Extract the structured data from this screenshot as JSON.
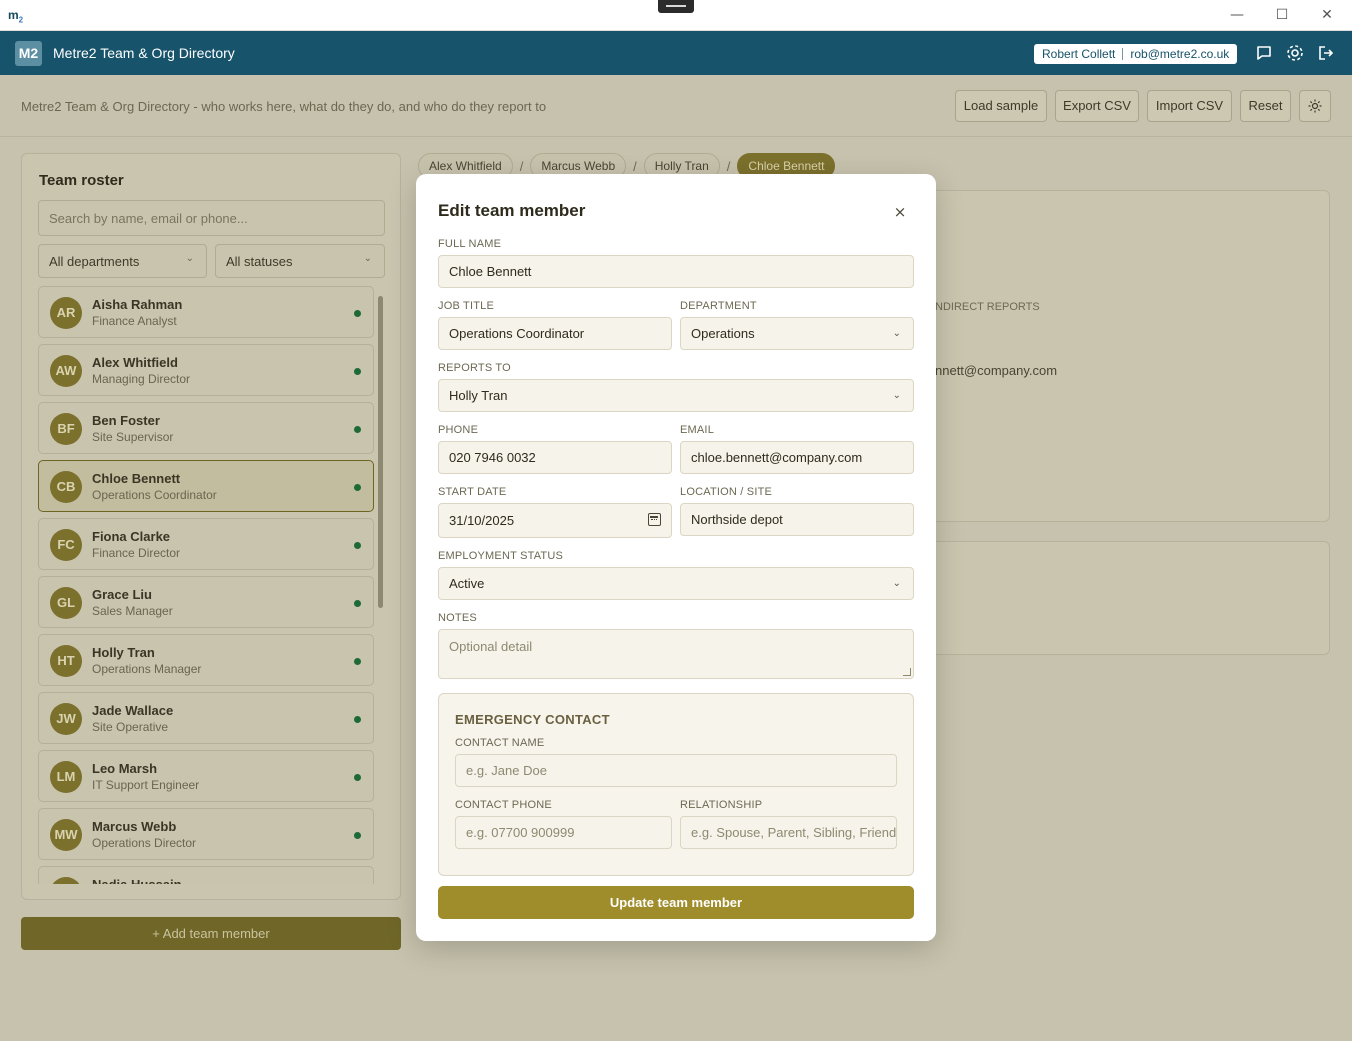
{
  "window": {
    "logo": "m",
    "logo_sub": "2",
    "minimize": "—",
    "maximize": "☐",
    "close": "✕"
  },
  "header": {
    "badge": "M2",
    "title": "Metre2 Team & Org Directory",
    "user_name": "Robert Collett",
    "user_email": "rob@metre2.co.uk"
  },
  "toolbar": {
    "subtitle": "Metre2 Team & Org Directory - who works here, what do they do, and who do they report to",
    "load_sample": "Load sample",
    "export_csv": "Export CSV",
    "import_csv": "Import CSV",
    "reset": "Reset"
  },
  "sidebar": {
    "heading": "Team roster",
    "search_placeholder": "Search by name, email or phone...",
    "department_filter": "All departments",
    "status_filter": "All statuses",
    "members": [
      {
        "initials": "AR",
        "name": "Aisha Rahman",
        "role": "Finance Analyst"
      },
      {
        "initials": "AW",
        "name": "Alex Whitfield",
        "role": "Managing Director"
      },
      {
        "initials": "BF",
        "name": "Ben Foster",
        "role": "Site Supervisor"
      },
      {
        "initials": "CB",
        "name": "Chloe Bennett",
        "role": "Operations Coordinator"
      },
      {
        "initials": "FC",
        "name": "Fiona Clarke",
        "role": "Finance Director"
      },
      {
        "initials": "GL",
        "name": "Grace Liu",
        "role": "Sales Manager"
      },
      {
        "initials": "HT",
        "name": "Holly Tran",
        "role": "Operations Manager"
      },
      {
        "initials": "JW",
        "name": "Jade Wallace",
        "role": "Site Operative"
      },
      {
        "initials": "LM",
        "name": "Leo Marsh",
        "role": "IT Support Engineer"
      },
      {
        "initials": "MW",
        "name": "Marcus Webb",
        "role": "Operations Director"
      },
      {
        "initials": "NH",
        "name": "Nadia Hussain",
        "role": ""
      }
    ],
    "add_button": "+ Add team member"
  },
  "breadcrumb": [
    "Alex Whitfield",
    "Marcus Webb",
    "Holly Tran",
    "Chloe Bennett"
  ],
  "background_panel": {
    "indirect_reports": "NDIRECT REPORTS",
    "email_partial": "nnett@company.com"
  },
  "modal": {
    "title": "Edit team member",
    "close_icon": "×",
    "full_name_label": "FULL NAME",
    "full_name": "Chloe Bennett",
    "job_title_label": "JOB TITLE",
    "job_title": "Operations Coordinator",
    "department_label": "DEPARTMENT",
    "department": "Operations",
    "reports_to_label": "REPORTS TO",
    "reports_to": "Holly Tran",
    "phone_label": "PHONE",
    "phone": "020 7946 0032",
    "email_label": "EMAIL",
    "email": "chloe.bennett@company.com",
    "start_date_label": "START DATE",
    "start_date": "31/10/2025",
    "location_label": "LOCATION / SITE",
    "location": "Northside depot",
    "status_label": "EMPLOYMENT STATUS",
    "status": "Active",
    "notes_label": "NOTES",
    "notes_placeholder": "Optional detail",
    "emergency": {
      "heading": "EMERGENCY CONTACT",
      "contact_name_label": "CONTACT NAME",
      "contact_name_placeholder": "e.g. Jane Doe",
      "contact_phone_label": "CONTACT PHONE",
      "contact_phone_placeholder": "e.g. 07700 900999",
      "relationship_label": "RELATIONSHIP",
      "relationship_placeholder": "e.g. Spouse, Parent, Sibling, Friend"
    },
    "submit": "Update team member"
  },
  "colors": {
    "header_bg": "#17536a",
    "accent": "#9f8c2b",
    "active_dot": "#1e6a35"
  }
}
